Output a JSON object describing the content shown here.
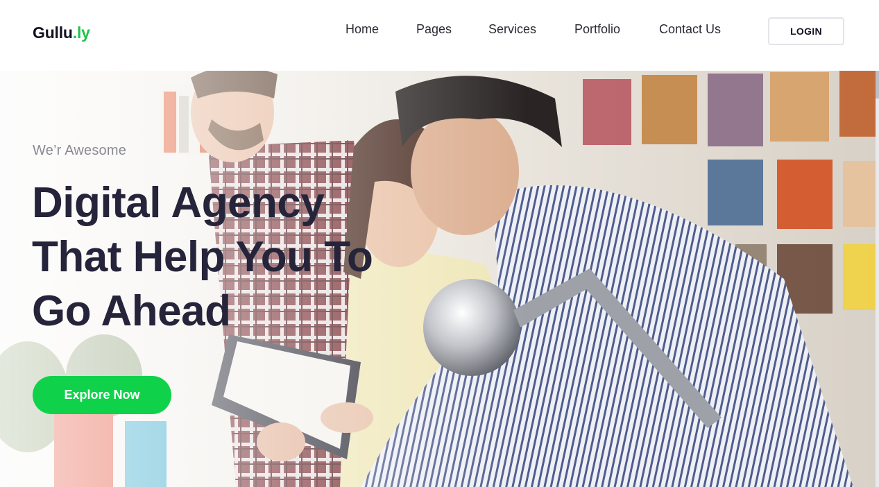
{
  "brand": {
    "logo_main": "Gullu",
    "logo_accent": ".ly",
    "accent_color": "#1fc24a"
  },
  "nav": {
    "items": [
      {
        "label": "Home"
      },
      {
        "label": "Pages"
      },
      {
        "label": "Services"
      },
      {
        "label": "Portfolio"
      },
      {
        "label": "Contact Us"
      }
    ],
    "login_label": "LOGIN"
  },
  "hero": {
    "tagline": "We’r Awesome",
    "headline_lines": [
      "Digital Agency",
      "That Help You To",
      "Go Ahead"
    ],
    "cta_label": "Explore Now",
    "cta_color": "#10d24a",
    "image": "team-meeting-photo"
  }
}
